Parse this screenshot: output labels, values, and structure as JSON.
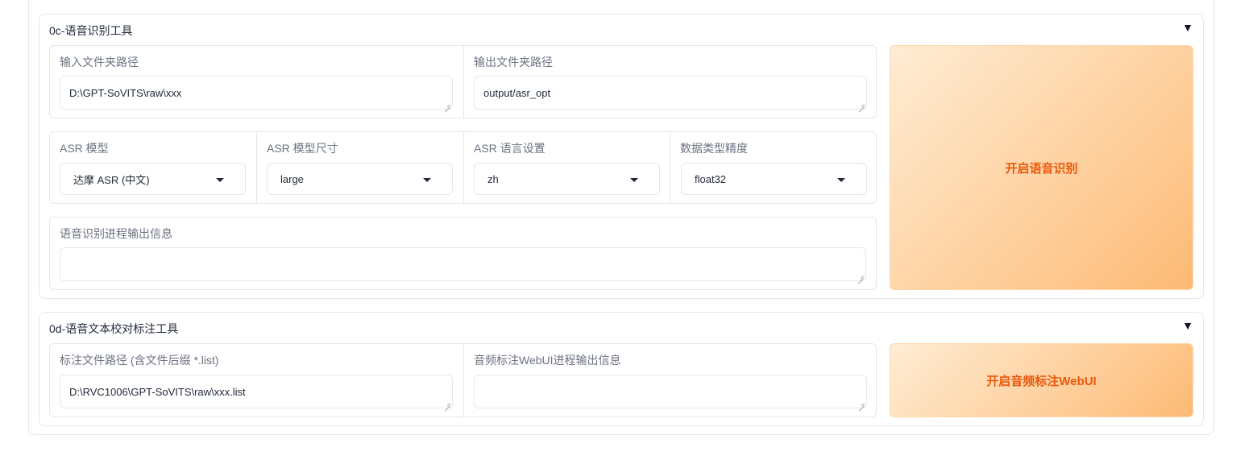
{
  "asr_section": {
    "title": "0c-语音识别工具",
    "collapse_icon": "caret-down-icon",
    "input_folder": {
      "label": "输入文件夹路径",
      "value": "D:\\GPT-SoVITS\\raw\\xxx"
    },
    "output_folder": {
      "label": "输出文件夹路径",
      "value": "output/asr_opt"
    },
    "asr_model": {
      "label": "ASR 模型",
      "value": "达摩 ASR (中文)"
    },
    "asr_model_size": {
      "label": "ASR 模型尺寸",
      "value": "large"
    },
    "asr_language": {
      "label": "ASR 语言设置",
      "value": "zh"
    },
    "dtype_precision": {
      "label": "数据类型精度",
      "value": "float32"
    },
    "progress_output": {
      "label": "语音识别进程输出信息",
      "value": ""
    },
    "start_button": "开启语音识别"
  },
  "label_section": {
    "title": "0d-语音文本校对标注工具",
    "collapse_icon": "caret-down-icon",
    "list_path": {
      "label": "标注文件路径 (含文件后缀 *.list)",
      "value": "D:\\RVC1006\\GPT-SoVITS\\raw\\xxx.list"
    },
    "webui_output": {
      "label": "音频标注WebUI进程输出信息",
      "value": ""
    },
    "start_button": "开启音频标注WebUI"
  },
  "colors": {
    "accent": "#ea580c",
    "button_gradient_start": "#ffedd5",
    "button_gradient_end": "#fdba74",
    "border": "#e5e7eb"
  }
}
